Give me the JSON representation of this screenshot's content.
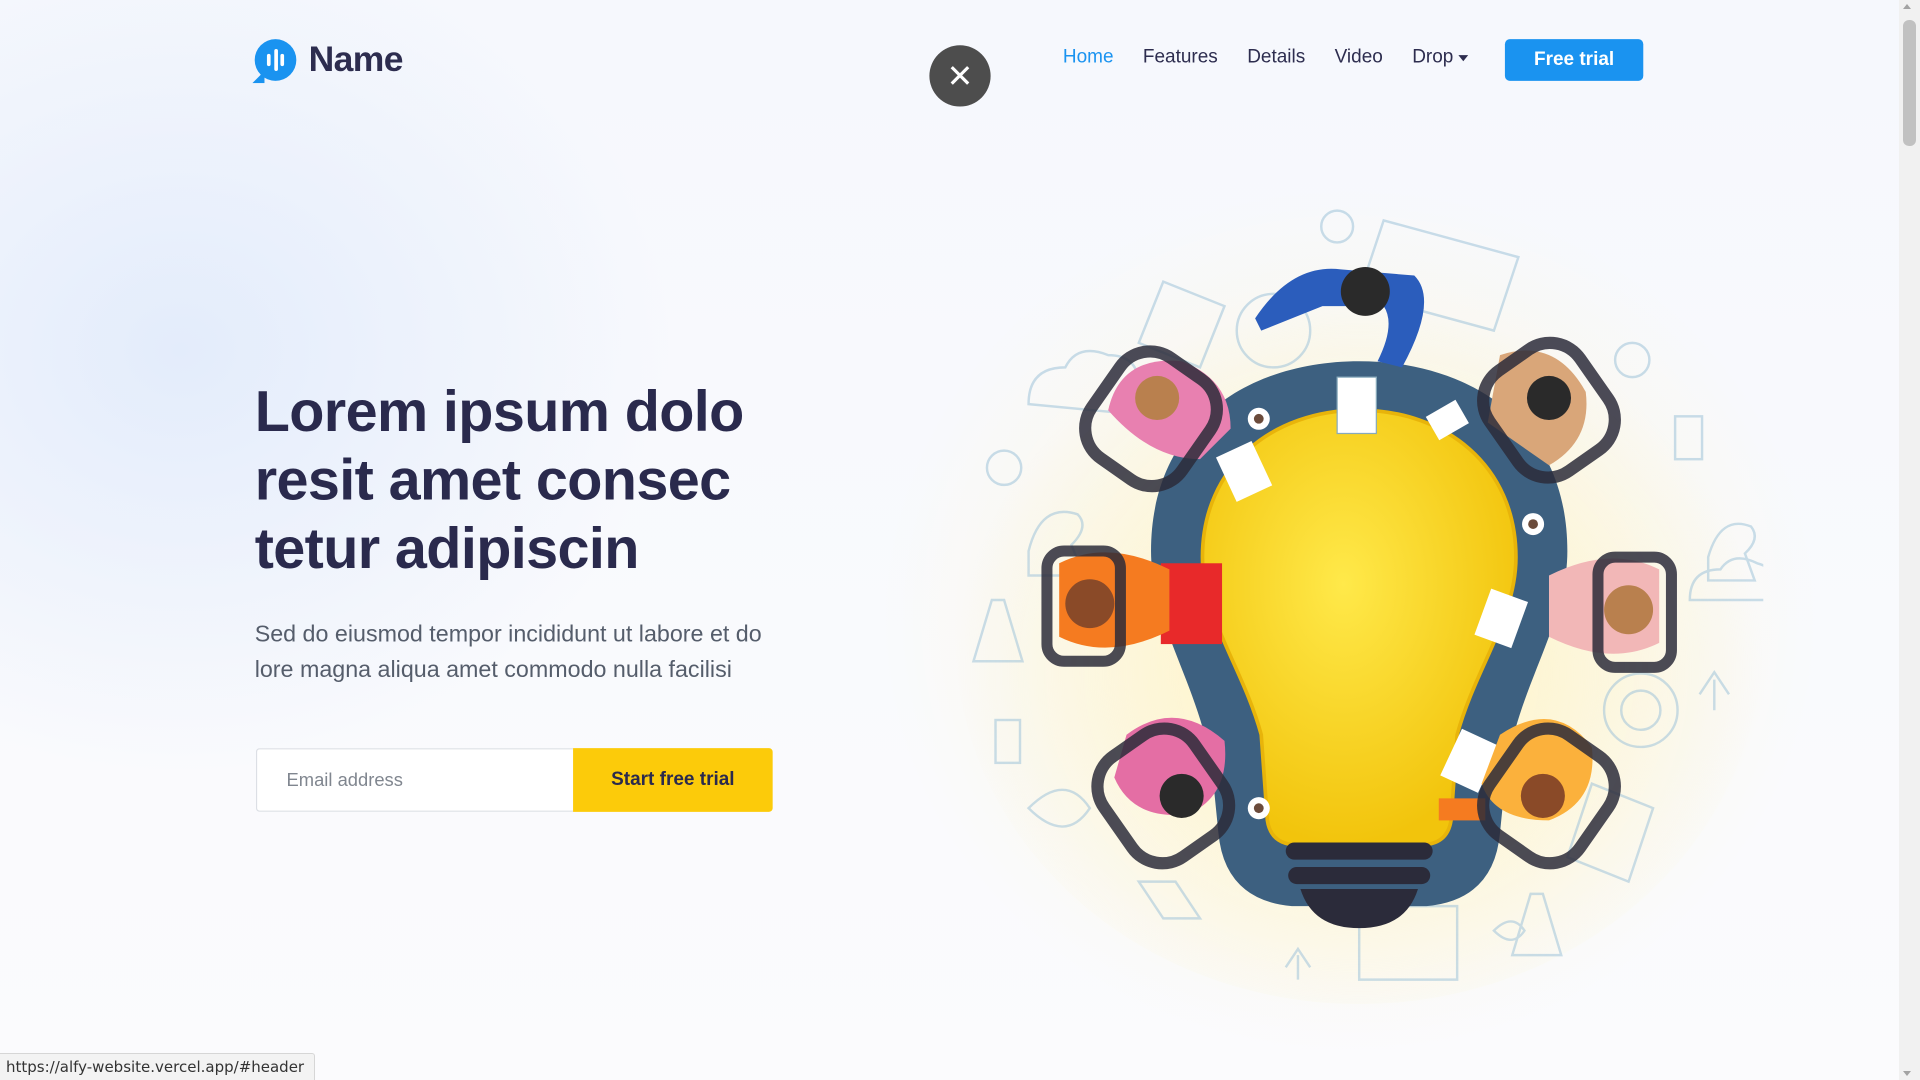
{
  "brand": {
    "name": "Name",
    "icon": "chat-bars-icon",
    "color": "#1a93f0"
  },
  "overlay": {
    "close_symbol": "✕"
  },
  "nav": {
    "items": [
      {
        "label": "Home",
        "active": true
      },
      {
        "label": "Features",
        "active": false
      },
      {
        "label": "Details",
        "active": false
      },
      {
        "label": "Video",
        "active": false
      },
      {
        "label": "Drop",
        "active": false,
        "has_dropdown": true
      }
    ],
    "cta": "Free trial"
  },
  "hero": {
    "title": "Lorem ipsum dolo resit amet consec tetur adipiscin",
    "subtitle": "Sed do eiusmod tempor incididunt ut labore et do lore magna aliqua amet commodo nulla facilisi",
    "email_placeholder": "Email address",
    "email_value": "",
    "submit_label": "Start free trial",
    "submit_color": "#fccb0a"
  },
  "illustration": {
    "subject": "lightbulb-meeting-table-illustration"
  },
  "status_bar": {
    "url": "https://alfy-website.vercel.app/#header"
  }
}
